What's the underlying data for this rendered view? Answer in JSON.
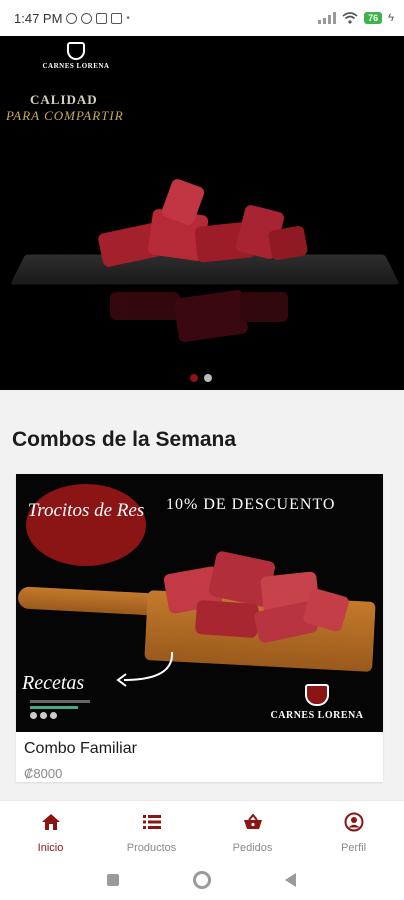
{
  "status_bar": {
    "time": "1:47 PM",
    "battery": "76"
  },
  "hero": {
    "brand": "CARNES LORENA",
    "tagline_line1": "CALIDAD",
    "tagline_line2": "PARA COMPARTIR",
    "slides_total": 2,
    "active_slide": 1
  },
  "section": {
    "title": "Combos de la Semana"
  },
  "combo_card": {
    "image_badge": "Trocitos de Res",
    "image_discount": "10% DE DESCUENTO",
    "image_recipes": "Recetas",
    "image_brand": "CARNES LORENA",
    "title": "Combo Familiar",
    "price": "₡8000"
  },
  "bottom_nav": {
    "items": [
      {
        "label": "Inicio",
        "icon": "home-icon",
        "active": true
      },
      {
        "label": "Productos",
        "icon": "list-icon",
        "active": false
      },
      {
        "label": "Pedidos",
        "icon": "basket-icon",
        "active": false
      },
      {
        "label": "Perfil",
        "icon": "profile-icon",
        "active": false
      }
    ]
  },
  "colors": {
    "brand_red": "#8b1414",
    "inactive_gray": "#8a8a8a"
  }
}
